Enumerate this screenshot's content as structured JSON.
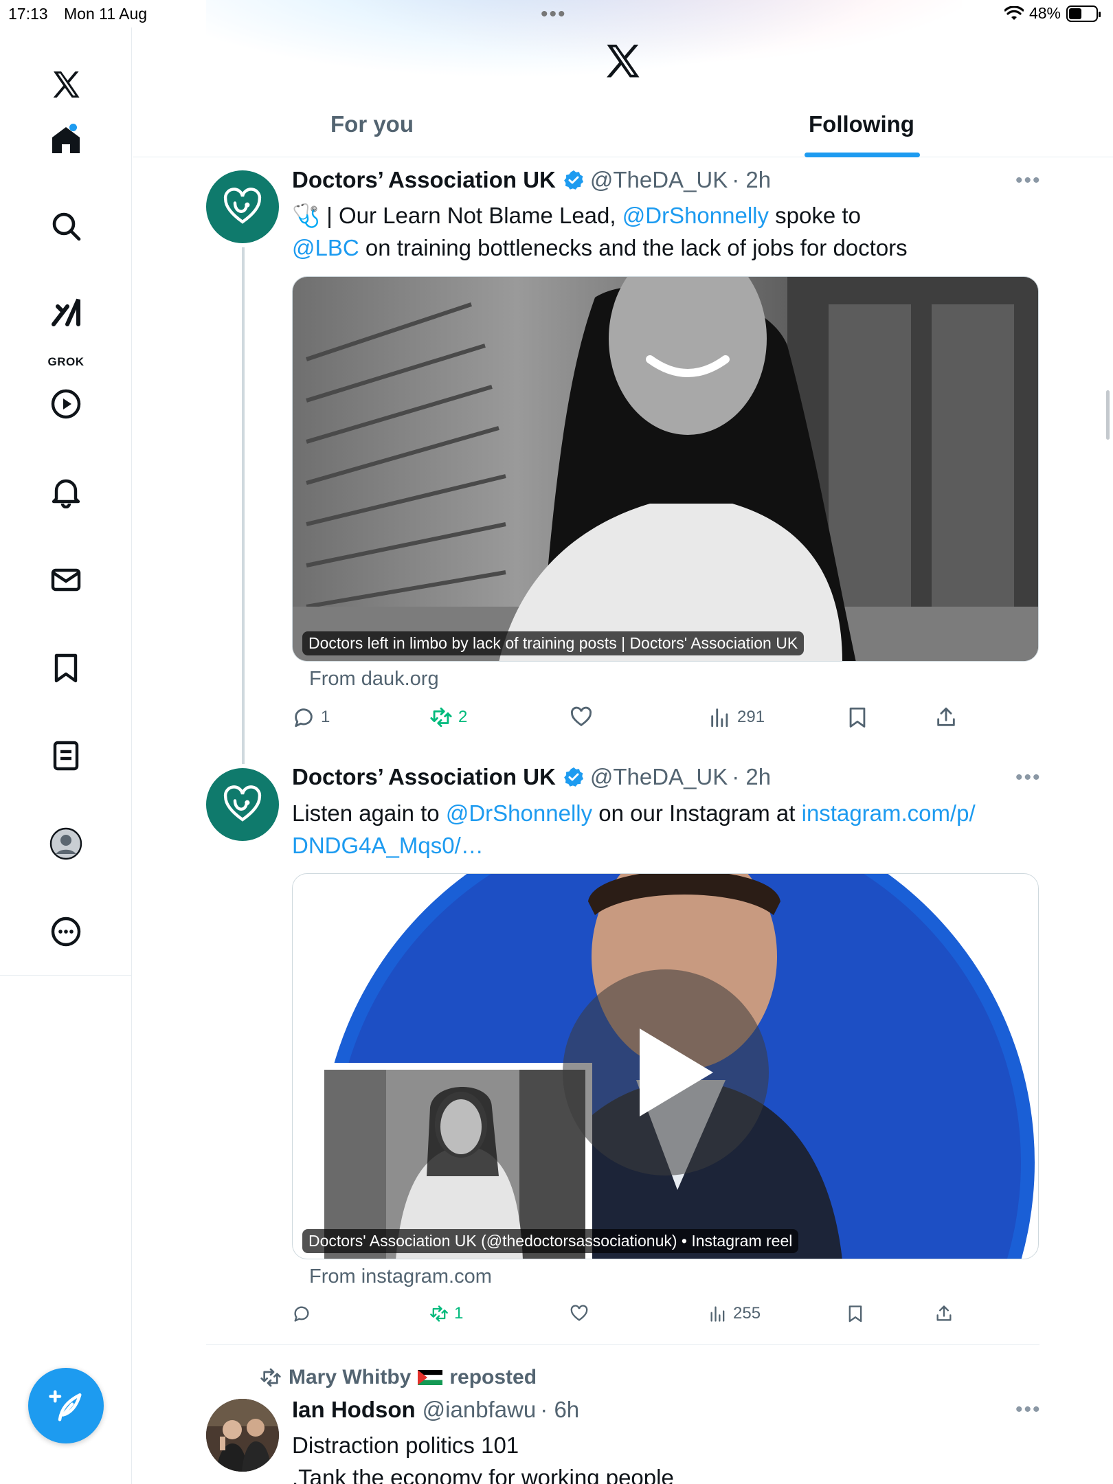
{
  "status_bar": {
    "time": "17:13",
    "date": "Mon 11 Aug",
    "battery": "48%",
    "battery_level": 0.48
  },
  "sidebar": {
    "items": [
      {
        "name": "home",
        "icon": "home-icon",
        "active": true,
        "has_notification_dot": true
      },
      {
        "name": "search",
        "icon": "search-icon"
      },
      {
        "name": "grok",
        "icon": "grok-icon",
        "label": "GROK"
      },
      {
        "name": "video",
        "icon": "play-icon"
      },
      {
        "name": "notifications",
        "icon": "bell-icon"
      },
      {
        "name": "messages",
        "icon": "mail-icon"
      },
      {
        "name": "bookmarks",
        "icon": "bookmark-icon"
      },
      {
        "name": "lists",
        "icon": "list-icon"
      },
      {
        "name": "profile",
        "icon": "profile-avatar-icon"
      },
      {
        "name": "more",
        "icon": "more-circle-icon"
      }
    ],
    "compose_icon": "compose-feather-icon"
  },
  "header": {
    "tabs": [
      {
        "label": "For you",
        "active": false
      },
      {
        "label": "Following",
        "active": true
      }
    ]
  },
  "colors": {
    "accent": "#1d9bf0",
    "retweet": "#00ba7c",
    "avatar_teal": "#0f7a6c",
    "muted": "#536471"
  },
  "tweets": [
    {
      "name": "Doctors’ Association UK",
      "verified": true,
      "handle": "@TheDA_UK",
      "time": "· 2h",
      "text_line1_prefix": "🩺 | Our Learn Not Blame Lead, ",
      "mention1": "@DrShonnelly",
      "text_line1_suffix": " spoke to",
      "mention2": "@LBC",
      "text_line2_suffix": " on training bottlenecks and the lack of jobs for doctors",
      "card_caption": "Doctors left in limbo by lack of training posts | Doctors' Association UK",
      "card_from": "From dauk.org",
      "replies": "1",
      "retweets": "2",
      "views": "291"
    },
    {
      "name": "Doctors’ Association UK",
      "verified": true,
      "handle": "@TheDA_UK",
      "time": "· 2h",
      "text_prefix": "Listen again to ",
      "mention1": "@DrShonnelly",
      "text_middle": " on our Instagram at ",
      "link_line1": "instagram.com/p/",
      "link_line2": "DNDG4A_Mqs0/…",
      "card_caption": "Doctors' Association UK (@thedoctorsassociationuk) • Instagram reel",
      "card_from": "From instagram.com",
      "retweets": "1",
      "views": "255"
    },
    {
      "repost_by": "Mary Whitby",
      "repost_suffix": "reposted",
      "name": "Ian Hodson",
      "handle": "@ianbfawu",
      "time": "· 6h",
      "text_line1": "Distraction politics 101",
      "text_line2": ".Tank the economy for working people"
    }
  ]
}
